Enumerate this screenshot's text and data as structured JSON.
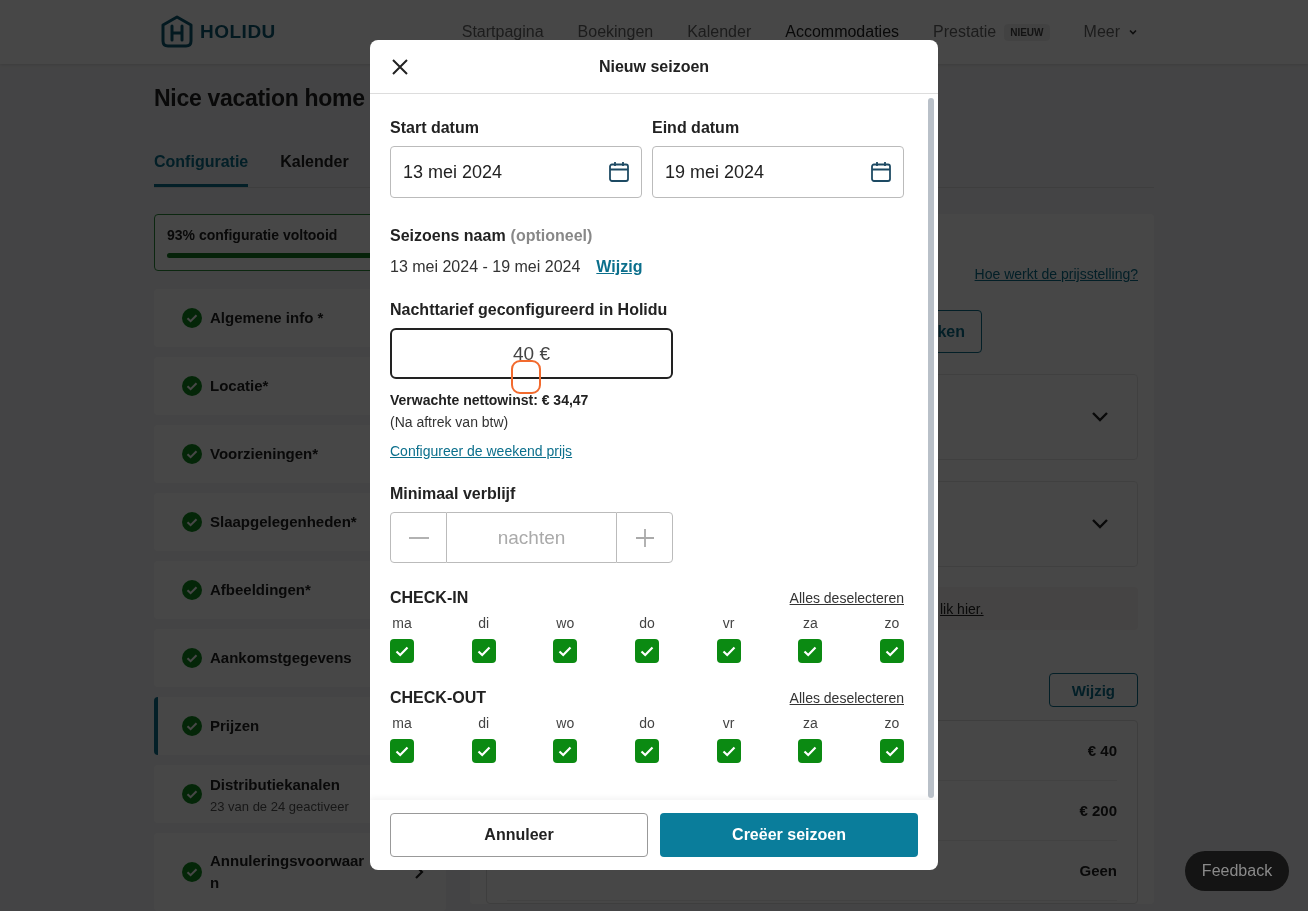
{
  "header": {
    "logo": "HOLIDU",
    "nav": [
      {
        "label": "Startpagina",
        "selected": false
      },
      {
        "label": "Boekingen",
        "selected": false
      },
      {
        "label": "Kalender",
        "selected": false
      },
      {
        "label": "Accommodaties",
        "selected": true
      },
      {
        "label": "Prestatie",
        "selected": false,
        "badge": "NIEUW"
      },
      {
        "label": "Meer",
        "selected": false,
        "kind": "menu"
      }
    ]
  },
  "page": {
    "title": "Nice vacation home",
    "tabs": [
      {
        "label": "Configuratie",
        "selected": true
      },
      {
        "label": "Kalender",
        "selected": false
      }
    ],
    "progress": {
      "label": "93% configuratie voltooid",
      "level": 0.93
    },
    "sections": [
      {
        "label": "Algemene info *",
        "done": true,
        "selected": false
      },
      {
        "label": "Locatie*",
        "done": true,
        "selected": false
      },
      {
        "label": "Voorzieningen*",
        "done": true,
        "selected": false
      },
      {
        "label": "Slaapgelegenheden*",
        "done": true,
        "selected": false
      },
      {
        "label": "Afbeeldingen*",
        "done": true,
        "selected": false
      },
      {
        "label": "Aankomstgegevens",
        "done": true,
        "selected": false
      },
      {
        "label": "Prijzen",
        "done": true,
        "selected": true
      },
      {
        "label": "Distributiekanalen",
        "subtitle": "23 van de 24 geactiveer",
        "done": true,
        "selected": false
      },
      {
        "label": "Annuleringsvoorwaar\nn",
        "done": true,
        "selected": false,
        "chevron": true
      }
    ]
  },
  "pricing": {
    "help_link": "Hoe werkt de prijsstelling?",
    "action_button": "ken",
    "panels": [
      {
        "expanded": false
      },
      {
        "expanded": false
      }
    ],
    "notice_link": "lik hier.",
    "edit_button": "Wijzig",
    "rates": [
      {
        "value": "€ 40"
      },
      {
        "value": "€ 200"
      },
      {
        "value": "Geen"
      }
    ]
  },
  "feedback_button": "Feedback",
  "modal": {
    "title": "Nieuw seizoen",
    "start_date": {
      "label": "Start datum",
      "value": "13 mei 2024"
    },
    "end_date": {
      "label": "Eind datum",
      "value": "19 mei 2024"
    },
    "season_name": {
      "label": "Seizoens naam",
      "hint": "(optioneel)",
      "value": "13 mei 2024 - 19 mei 2024",
      "edit_link": "Wijzig"
    },
    "nightly_rate": {
      "label": "Nachttarief geconfigureerd in Holidu",
      "value": "40 €",
      "net_profit": "Verwachte nettowinst: € 34,47",
      "note": "(Na aftrek van btw)",
      "weekend_link": "Configureer de weekend prijs"
    },
    "min_stay": {
      "label": "Minimaal verblijf",
      "placeholder": "nachten"
    },
    "checkin": {
      "title": "CHECK-IN",
      "deselect_link": "Alles deselecteren",
      "days": [
        {
          "label": "ma",
          "checked": true
        },
        {
          "label": "di",
          "checked": true
        },
        {
          "label": "wo",
          "checked": true
        },
        {
          "label": "do",
          "checked": true
        },
        {
          "label": "vr",
          "checked": true
        },
        {
          "label": "za",
          "checked": true
        },
        {
          "label": "zo",
          "checked": true
        }
      ]
    },
    "checkout": {
      "title": "CHECK-OUT",
      "deselect_link": "Alles deselecteren",
      "days": [
        {
          "label": "ma",
          "checked": true
        },
        {
          "label": "di",
          "checked": true
        },
        {
          "label": "wo",
          "checked": true
        },
        {
          "label": "do",
          "checked": true
        },
        {
          "label": "vr",
          "checked": true
        },
        {
          "label": "za",
          "checked": true
        },
        {
          "label": "zo",
          "checked": true
        }
      ]
    },
    "cancel_button": "Annuleer",
    "create_button": "Creëer seizoen"
  }
}
